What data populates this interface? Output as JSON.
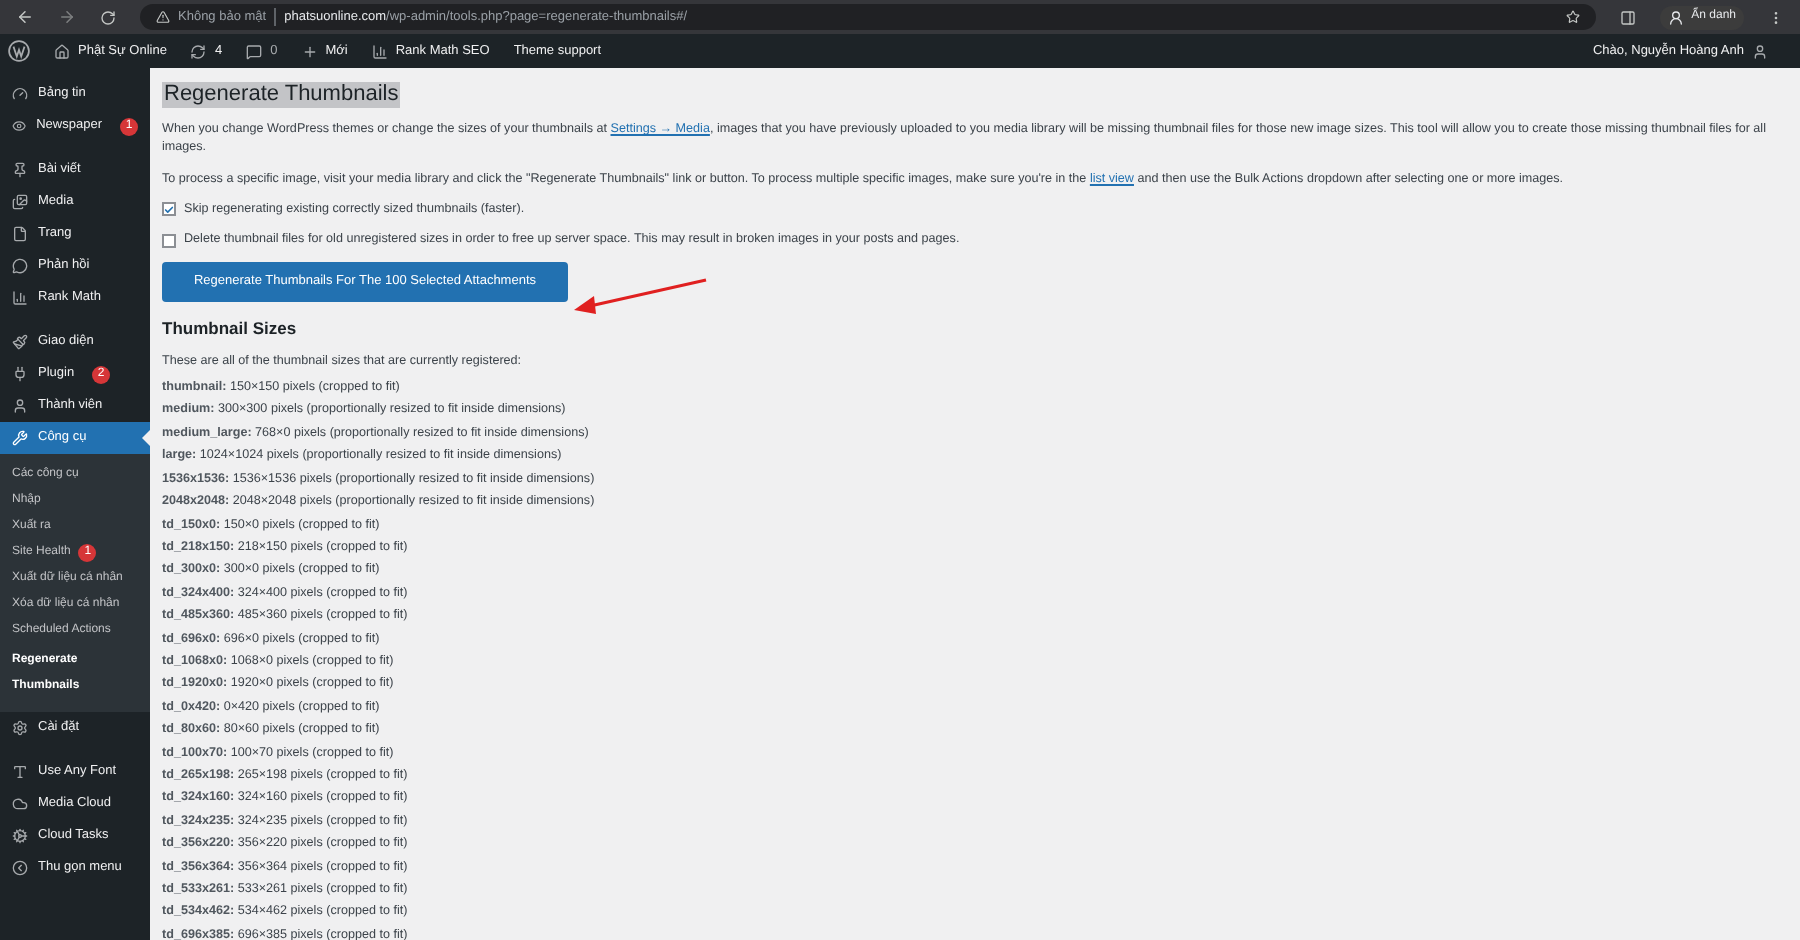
{
  "browser": {
    "security": "Không bảo mật",
    "url_host": "phatsuonline.com",
    "url_path": "/wp-admin/tools.php?page=regenerate-thumbnails#/",
    "profile": "Ẩn danh"
  },
  "admin_bar": {
    "site": "Phật Sự Online",
    "updates": "4",
    "comments": "0",
    "new": "Mới",
    "rank_math": "Rank Math SEO",
    "theme_support": "Theme support",
    "greeting": "Chào, Nguyễn Hoàng Anh"
  },
  "sidebar": {
    "groups": [
      {
        "items": [
          {
            "label": "Bảng tin",
            "selected": false
          },
          {
            "label": "Newspaper",
            "badge": "1",
            "selected": false
          }
        ]
      },
      {
        "items": [
          {
            "label": "Bài viết",
            "selected": false
          },
          {
            "label": "Media",
            "selected": false
          },
          {
            "label": "Trang",
            "selected": false
          },
          {
            "label": "Phản hồi",
            "selected": false
          },
          {
            "label": "Rank Math",
            "selected": false
          }
        ]
      },
      {
        "items": [
          {
            "label": "Giao diện",
            "selected": false
          },
          {
            "label": "Plugin",
            "badge": "2",
            "selected": false
          },
          {
            "label": "Thành viên",
            "selected": false
          },
          {
            "label": "Công cụ",
            "selected": true,
            "children": [
              {
                "label": "Các công cụ",
                "selected": false
              },
              {
                "label": "Nhập",
                "selected": false
              },
              {
                "label": "Xuất ra",
                "selected": false
              },
              {
                "label": "Site Health",
                "badge": "1",
                "selected": false
              },
              {
                "label": "Xuất dữ liệu cá nhân",
                "selected": false
              },
              {
                "label": "Xóa dữ liệu cá nhân",
                "selected": false
              },
              {
                "label": "Scheduled Actions",
                "selected": false
              },
              {
                "label": "Regenerate Thumbnails",
                "selected": true
              }
            ]
          },
          {
            "label": "Cài đặt",
            "selected": false
          }
        ]
      },
      {
        "items": [
          {
            "label": "Use Any Font",
            "selected": false
          },
          {
            "label": "Media Cloud",
            "selected": false
          },
          {
            "label": "Cloud Tasks",
            "selected": false
          },
          {
            "label": "Thu gọn menu",
            "selected": false
          }
        ]
      }
    ]
  },
  "content": {
    "title": "Regenerate Thumbnails",
    "intro": "When you change WordPress themes or change the sizes of your thumbnails at ",
    "intro_link": "Settings → Media",
    "intro_rest": ", images that you have previously uploaded to you media library will be missing thumbnail files for those new image sizes. This tool will allow you to create those missing thumbnail files for all images.",
    "process": "To process a specific image, visit your media library and click the \"Regenerate Thumbnails\" link or button. To process multiple specific images, make sure you're in the ",
    "process_link": "list view",
    "process_rest": " and then use the Bulk Actions dropdown after selecting one or more images.",
    "options": [
      {
        "label": "Skip regenerating existing correctly sized thumbnails (faster).",
        "checked": true
      },
      {
        "label": "Delete thumbnail files for old unregistered sizes in order to free up server space. This may result in broken images in your posts and pages.",
        "checked": false
      }
    ],
    "button": "Regenerate Thumbnails For The 100 Selected Attachments",
    "sizes_heading": "Thumbnail Sizes",
    "sizes_intro": "These are all of the thumbnail sizes that are currently registered:",
    "sizes": [
      {
        "name": "thumbnail:",
        "detail": "150×150 pixels (cropped to fit)"
      },
      {
        "name": "medium:",
        "detail": "300×300 pixels (proportionally resized to fit inside dimensions)"
      },
      {
        "name": "medium_large:",
        "detail": "768×0 pixels (proportionally resized to fit inside dimensions)"
      },
      {
        "name": "large:",
        "detail": "1024×1024 pixels (proportionally resized to fit inside dimensions)"
      },
      {
        "name": "1536x1536:",
        "detail": "1536×1536 pixels (proportionally resized to fit inside dimensions)"
      },
      {
        "name": "2048x2048:",
        "detail": "2048×2048 pixels (proportionally resized to fit inside dimensions)"
      },
      {
        "name": "td_150x0:",
        "detail": "150×0 pixels (cropped to fit)"
      },
      {
        "name": "td_218x150:",
        "detail": "218×150 pixels (cropped to fit)"
      },
      {
        "name": "td_300x0:",
        "detail": "300×0 pixels (cropped to fit)"
      },
      {
        "name": "td_324x400:",
        "detail": "324×400 pixels (cropped to fit)"
      },
      {
        "name": "td_485x360:",
        "detail": "485×360 pixels (cropped to fit)"
      },
      {
        "name": "td_696x0:",
        "detail": "696×0 pixels (cropped to fit)"
      },
      {
        "name": "td_1068x0:",
        "detail": "1068×0 pixels (cropped to fit)"
      },
      {
        "name": "td_1920x0:",
        "detail": "1920×0 pixels (cropped to fit)"
      },
      {
        "name": "td_0x420:",
        "detail": "0×420 pixels (cropped to fit)"
      },
      {
        "name": "td_80x60:",
        "detail": "80×60 pixels (cropped to fit)"
      },
      {
        "name": "td_100x70:",
        "detail": "100×70 pixels (cropped to fit)"
      },
      {
        "name": "td_265x198:",
        "detail": "265×198 pixels (cropped to fit)"
      },
      {
        "name": "td_324x160:",
        "detail": "324×160 pixels (cropped to fit)"
      },
      {
        "name": "td_324x235:",
        "detail": "324×235 pixels (cropped to fit)"
      },
      {
        "name": "td_356x220:",
        "detail": "356×220 pixels (cropped to fit)"
      },
      {
        "name": "td_356x364:",
        "detail": "356×364 pixels (cropped to fit)"
      },
      {
        "name": "td_533x261:",
        "detail": "533×261 pixels (cropped to fit)"
      },
      {
        "name": "td_534x462:",
        "detail": "534×462 pixels (cropped to fit)"
      },
      {
        "name": "td_696x385:",
        "detail": "696×385 pixels (cropped to fit)"
      }
    ]
  }
}
